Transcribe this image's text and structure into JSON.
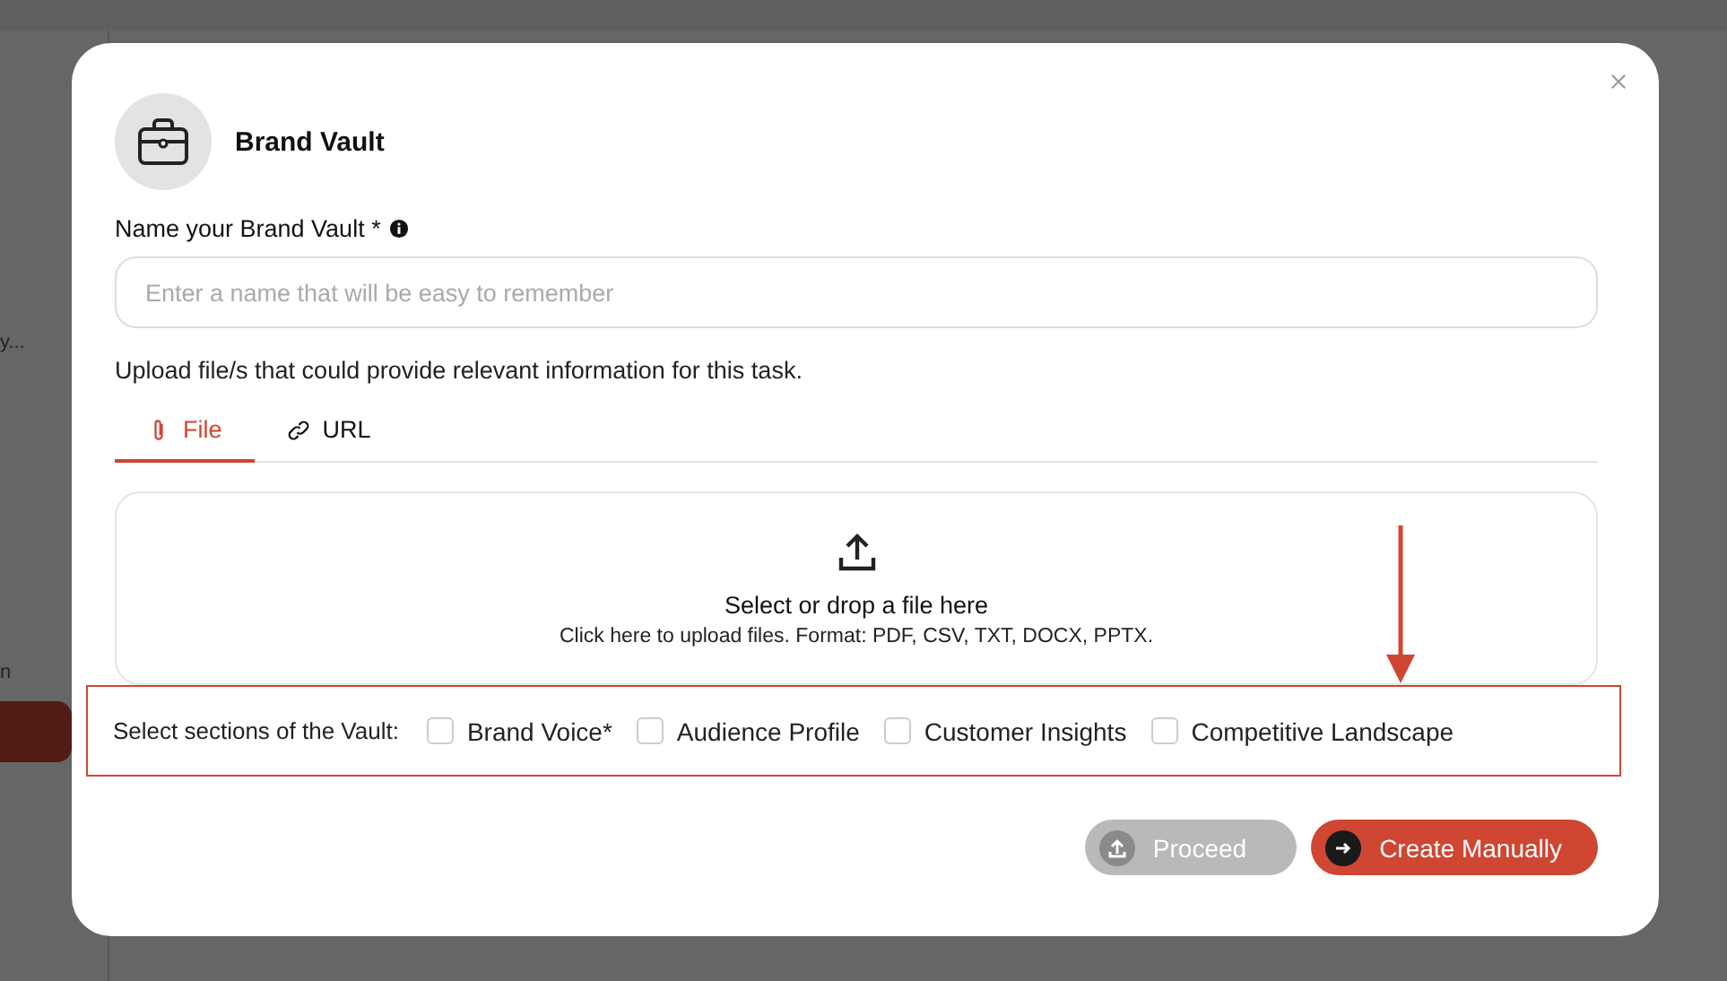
{
  "background": {
    "texts": [
      "y...",
      "n"
    ]
  },
  "modal": {
    "title": "Brand Vault",
    "name_field": {
      "label": "Name your Brand Vault *",
      "placeholder": "Enter a name that will be easy to remember"
    },
    "upload_hint": "Upload file/s that could provide relevant information for this task.",
    "tabs": [
      {
        "label": "File",
        "selected": true
      },
      {
        "label": "URL",
        "selected": false
      }
    ],
    "dropzone": {
      "title": "Select or drop a file here",
      "subtitle": "Click here to upload files. Format: PDF, CSV, TXT, DOCX, PPTX."
    },
    "sections": {
      "label": "Select sections of the Vault:",
      "highlighted": true,
      "options": [
        {
          "label": "Brand Voice*",
          "checked": false
        },
        {
          "label": "Audience Profile",
          "checked": false
        },
        {
          "label": "Customer Insights",
          "checked": false
        },
        {
          "label": "Competitive Landscape",
          "checked": false
        }
      ]
    },
    "buttons": [
      {
        "label": "Proceed",
        "kind": "upload",
        "disabled": true
      },
      {
        "label": "Create Manually",
        "kind": "arrow",
        "disabled": false
      }
    ]
  }
}
